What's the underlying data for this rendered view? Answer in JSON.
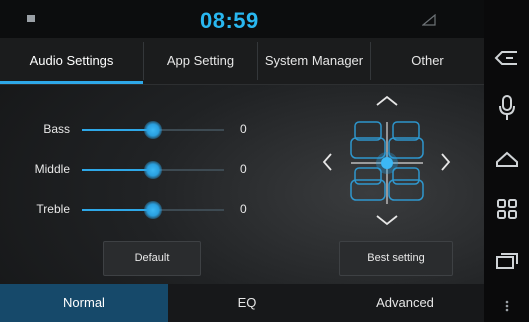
{
  "status": {
    "time": "08:59"
  },
  "tabs": [
    {
      "label": "Audio Settings",
      "active": true
    },
    {
      "label": "App Setting",
      "active": false
    },
    {
      "label": "System Manager",
      "active": false
    },
    {
      "label": "Other",
      "active": false
    }
  ],
  "sliders": [
    {
      "label": "Bass",
      "value": "0",
      "level": 0.5
    },
    {
      "label": "Middle",
      "value": "0",
      "level": 0.5
    },
    {
      "label": "Treble",
      "value": "0",
      "level": 0.5
    }
  ],
  "buttons": {
    "default_label": "Default",
    "best_label": "Best setting"
  },
  "modes": [
    {
      "label": "Normal",
      "active": true
    },
    {
      "label": "EQ",
      "active": false
    },
    {
      "label": "Advanced",
      "active": false
    }
  ],
  "sidenav": [
    "back-icon",
    "microphone-icon",
    "home-icon",
    "apps-grid-icon",
    "recent-apps-icon",
    "more-icon"
  ],
  "colors": {
    "accent": "#2ea8e8",
    "clock": "#29b7f0",
    "active_mode": "#16496a"
  }
}
